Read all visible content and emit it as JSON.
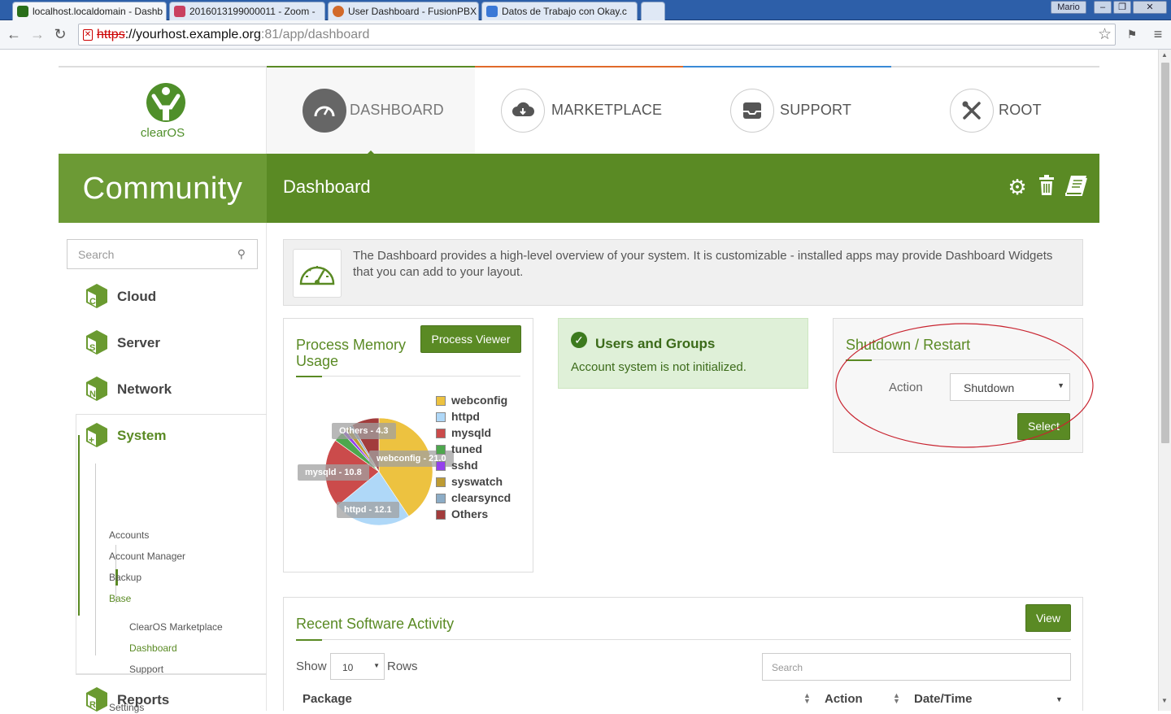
{
  "browser": {
    "tabs": [
      {
        "label": "localhost.localdomain - Dashb",
        "active": true
      },
      {
        "label": "2016013199000011 - Zoom -"
      },
      {
        "label": "User Dashboard - FusionPBX"
      },
      {
        "label": "Datos de Trabajo con Okay.c"
      }
    ],
    "user": "Mario",
    "url": {
      "scheme": "https",
      "rest": "://yourhost.example.org",
      "port": ":81",
      "path": "/app/dashboard"
    }
  },
  "brand": {
    "name": "clearOS",
    "accent": "#5a8a24"
  },
  "topnav": [
    {
      "label": "DASHBOARD",
      "icon": "gauge-icon"
    },
    {
      "label": "MARKETPLACE",
      "icon": "cloud-download-icon"
    },
    {
      "label": "SUPPORT",
      "icon": "inbox-icon"
    },
    {
      "label": "ROOT",
      "icon": "tools-icon"
    }
  ],
  "edition": "Community",
  "page_title": "Dashboard",
  "sidebar": {
    "search_placeholder": "Search",
    "categories": [
      "Cloud",
      "Server",
      "Network",
      "System",
      "Reports"
    ],
    "system_items": [
      "Accounts",
      "Account Manager",
      "Backup",
      "Base",
      "Settings"
    ],
    "base_items": [
      "ClearOS Marketplace",
      "Dashboard",
      "Support"
    ]
  },
  "intro_text": "The Dashboard provides a high-level overview of your system. It is customizable - installed apps may provide Dashboard Widgets that you can add to your layout.",
  "memory_widget": {
    "title": "Process Memory Usage",
    "button": "Process Viewer",
    "slice_labels": [
      "webconfig - 21.0",
      "httpd - 12.1",
      "mysqld - 10.8",
      "Others - 4.3"
    ]
  },
  "chart_data": {
    "type": "pie",
    "categories": [
      "webconfig",
      "httpd",
      "mysqld",
      "tuned",
      "sshd",
      "syswatch",
      "clearsyncd",
      "Others"
    ],
    "values": [
      21.0,
      12.1,
      10.8,
      1.6,
      0.6,
      0.8,
      0.5,
      4.3
    ],
    "colors": [
      "#edc240",
      "#afd8f8",
      "#cb4b4b",
      "#4da74d",
      "#9440ed",
      "#bd9b33",
      "#8cacc6",
      "#a23c3c"
    ]
  },
  "users_widget": {
    "title": "Users and Groups",
    "message": "Account system is not initialized."
  },
  "shutdown_widget": {
    "title": "Shutdown / Restart",
    "action_label": "Action",
    "action_value": "Shutdown",
    "button": "Select"
  },
  "activity_widget": {
    "title": "Recent Software Activity",
    "button": "View",
    "show_label": "Show",
    "rows_value": "10",
    "rows_label": "Rows",
    "search_placeholder": "Search",
    "columns": [
      "Package",
      "Action",
      "Date/Time"
    ]
  }
}
